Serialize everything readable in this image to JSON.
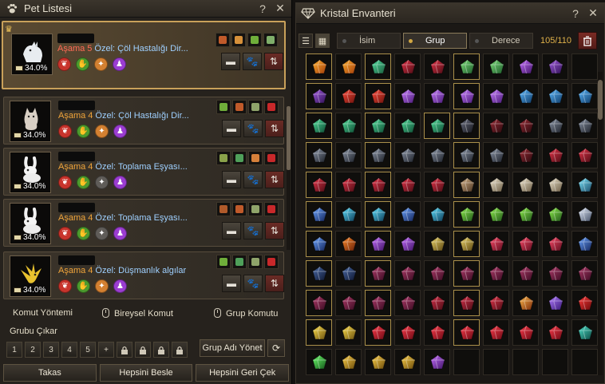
{
  "pet_window": {
    "title": "Pet Listesi",
    "help": "?",
    "close": "✕",
    "pets": [
      {
        "stage": "Aşama 5",
        "stage_color": "red",
        "special": "Özel: Çöl Hastalığı Dir...",
        "level": "34.0%",
        "animal": "wolf",
        "skills": [
          "red",
          "green",
          "orange",
          "purple"
        ]
      },
      {
        "stage": "Aşama 4",
        "stage_color": "orange",
        "special": "Özel: Çöl Hastalığı Dir...",
        "level": "34.0%",
        "animal": "cat",
        "skills": [
          "red",
          "green",
          "orange",
          "purple"
        ]
      },
      {
        "stage": "Aşama 4",
        "stage_color": "orange",
        "special": "Özel: Toplama Eşyası...",
        "level": "34.0%",
        "animal": "rabbit",
        "skills": [
          "red",
          "green",
          "gray",
          "purple"
        ]
      },
      {
        "stage": "Aşama 4",
        "stage_color": "orange",
        "special": "Özel: Toplama Eşyası...",
        "level": "34.0%",
        "animal": "rabbit",
        "skills": [
          "red",
          "green",
          "gray",
          "purple"
        ]
      },
      {
        "stage": "Aşama 4",
        "stage_color": "orange",
        "special": "Özel: Düşmanlık algılar",
        "level": "34.0%",
        "animal": "bird",
        "skills": [
          "red",
          "green",
          "orange",
          "purple"
        ]
      }
    ],
    "command_method": "Komut Yöntemi",
    "individual_command": "Bireysel Komut",
    "group_command": "Grup Komutu",
    "group_remove": "Grubu Çıkar",
    "group_buttons": [
      "1",
      "2",
      "3",
      "4",
      "5"
    ],
    "plus": "+",
    "group_name_button": "Grup Adı Yönet",
    "bottom_buttons": [
      "Takas",
      "Hepsini Besle",
      "Hepsini Geri Çek"
    ]
  },
  "crystal_window": {
    "title": "Kristal Envanteri",
    "help": "?",
    "close": "✕",
    "sort_name": "İsim",
    "sort_group": "Grup",
    "sort_grade": "Derece",
    "count": "105/110",
    "colors": {
      "accent": "#d2a843",
      "border_gold": "#a98f4a"
    }
  }
}
